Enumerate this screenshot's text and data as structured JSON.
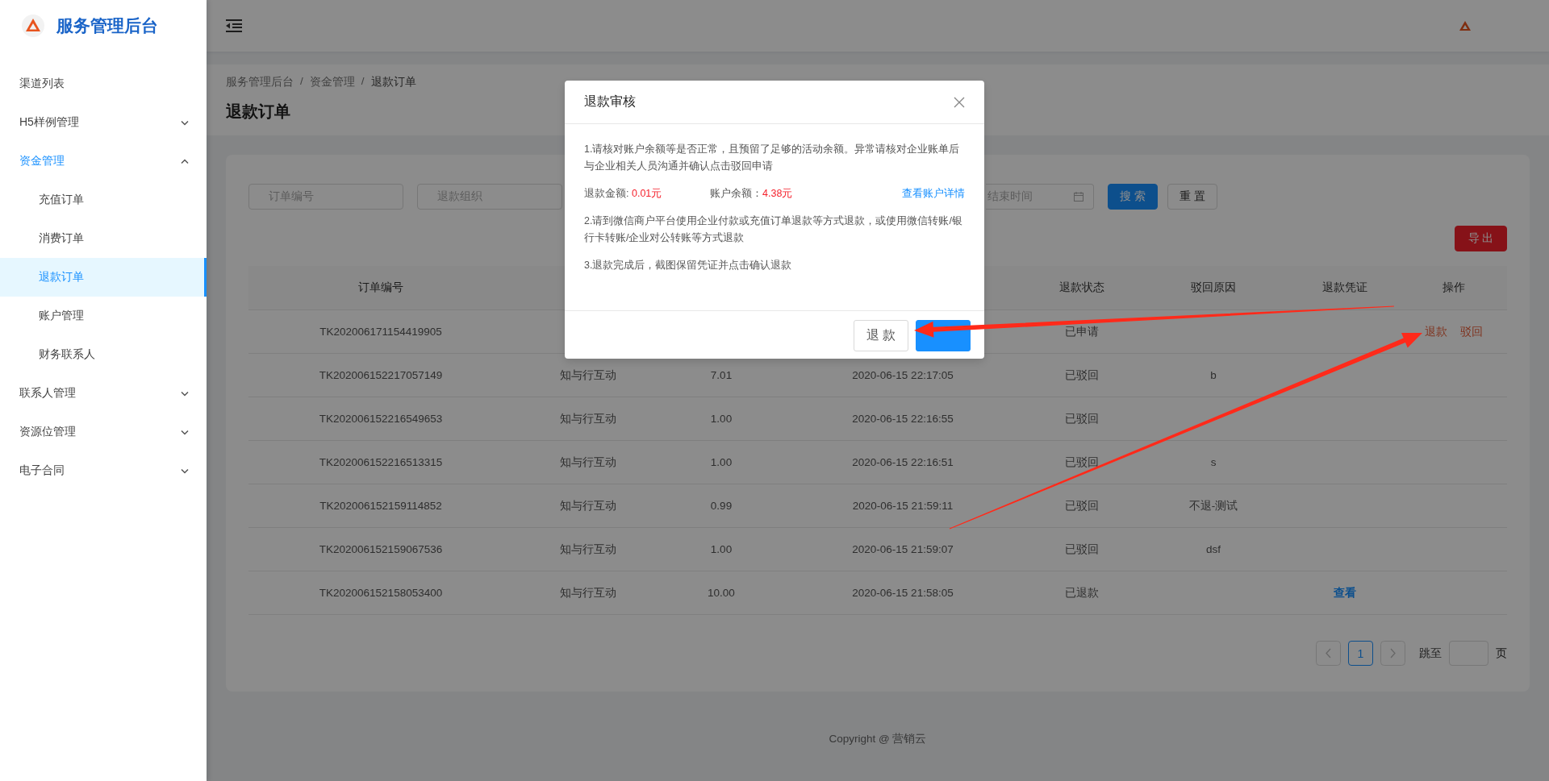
{
  "app": {
    "title": "服务管理后台"
  },
  "sidebar": {
    "items": [
      {
        "label": "渠道列表",
        "kind": "item",
        "selected": false
      },
      {
        "label": "H5样例管理",
        "kind": "submenu",
        "expanded": false,
        "selected": false
      },
      {
        "label": "资金管理",
        "kind": "submenu",
        "expanded": true,
        "selected": false,
        "children": [
          {
            "label": "充值订单",
            "selected": false
          },
          {
            "label": "消费订单",
            "selected": false
          },
          {
            "label": "退款订单",
            "selected": true
          },
          {
            "label": "账户管理",
            "selected": false
          },
          {
            "label": "财务联系人",
            "selected": false
          }
        ]
      },
      {
        "label": "联系人管理",
        "kind": "submenu",
        "expanded": false,
        "selected": false
      },
      {
        "label": "资源位管理",
        "kind": "submenu",
        "expanded": false,
        "selected": false
      },
      {
        "label": "电子合同",
        "kind": "submenu",
        "expanded": false,
        "selected": false
      }
    ]
  },
  "breadcrumb": [
    {
      "label": "服务管理后台",
      "separator": "/"
    },
    {
      "label": "资金管理",
      "separator": "/"
    },
    {
      "label": "退款订单"
    }
  ],
  "page_title": "退款订单",
  "filters": [
    {
      "kind": "text",
      "placeholder": "订单编号"
    },
    {
      "kind": "text",
      "placeholder": "退款组织"
    },
    {
      "kind": "date",
      "placeholder": "结束时间"
    }
  ],
  "filter_buttons": [
    {
      "label": "搜 索",
      "kind": "primary"
    },
    {
      "label": "重 置",
      "kind": "default"
    }
  ],
  "export_button": "导 出",
  "table": {
    "columns": [
      {
        "label": "订单编号"
      },
      {},
      {},
      {},
      {
        "label": "退款状态"
      },
      {
        "label": "驳回原因"
      },
      {
        "label": "退款凭证"
      },
      {
        "label": "操作"
      }
    ],
    "rows": [
      {
        "cells": [
          "TK202006171154419905",
          null,
          null,
          null,
          "已申请",
          null,
          null,
          {
            "kind": "actions",
            "links": [
              "退款",
              "驳回"
            ]
          }
        ]
      },
      {
        "cells": [
          "TK202006152217057149",
          "知与行互动",
          "7.01",
          "2020-06-15 22:17:05",
          "已驳回",
          "b",
          null,
          null
        ]
      },
      {
        "cells": [
          "TK202006152216549653",
          "知与行互动",
          "1.00",
          "2020-06-15 22:16:55",
          "已驳回",
          null,
          null,
          null
        ]
      },
      {
        "cells": [
          "TK202006152216513315",
          "知与行互动",
          "1.00",
          "2020-06-15 22:16:51",
          "已驳回",
          "s",
          null,
          null
        ]
      },
      {
        "cells": [
          "TK202006152159114852",
          "知与行互动",
          "0.99",
          "2020-06-15 21:59:11",
          "已驳回",
          "不退-测试",
          null,
          null
        ]
      },
      {
        "cells": [
          "TK202006152159067536",
          "知与行互动",
          "1.00",
          "2020-06-15 21:59:07",
          "已驳回",
          "dsf",
          null,
          null
        ]
      },
      {
        "cells": [
          "TK202006152158053400",
          "知与行互动",
          "10.00",
          "2020-06-15 21:58:05",
          "已退款",
          null,
          {
            "kind": "link",
            "text": "查看"
          },
          null
        ]
      }
    ]
  },
  "pagination": {
    "pages": [
      {
        "label": "1",
        "selected": true
      }
    ],
    "jump_label": "跳至",
    "page_suffix": "页"
  },
  "footer": "Copyright @ 营销云",
  "modal": {
    "title": "退款审核",
    "paragraphs_before": [
      "1.请核对账户余额等是否正常，且预留了足够的活动余额。异常请核对企业账单后与企业相关人员沟通并确认点击驳回申请"
    ],
    "amounts": [
      {
        "label": "退款金额: ",
        "value": "0.01元"
      },
      {
        "label": "账户余额：",
        "value": "4.38元"
      }
    ],
    "amounts_link": "查看账户详情",
    "paragraphs_after": [
      "2.请到微信商户平台使用企业付款或充值订单退款等方式退款，或使用微信转账/银行卡转账/企业对公转账等方式退款",
      "3.退款完成后，截图保留凭证并点击确认退款"
    ],
    "buttons": [
      {
        "label": "退 款",
        "kind": "default"
      },
      {
        "kind": "primary"
      }
    ]
  }
}
